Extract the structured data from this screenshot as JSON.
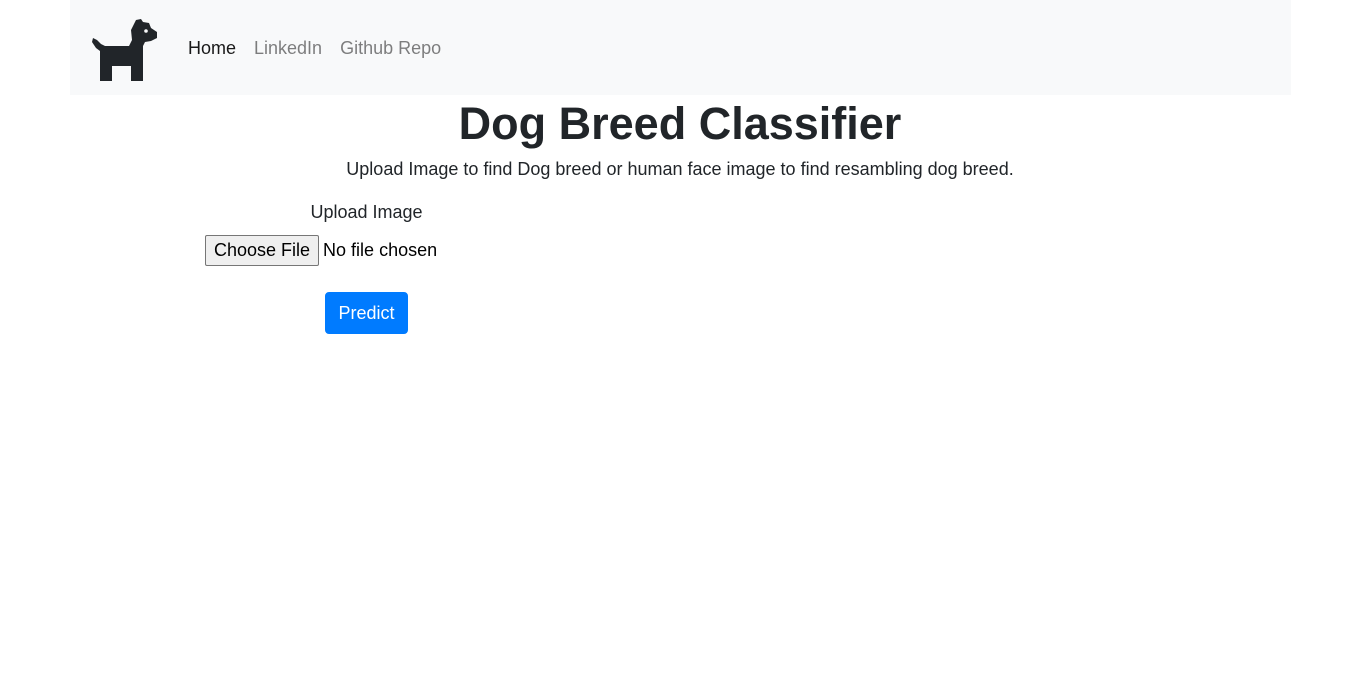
{
  "nav": {
    "logo_icon": "dog-icon",
    "items": [
      {
        "label": "Home",
        "active": true
      },
      {
        "label": "LinkedIn",
        "active": false
      },
      {
        "label": "Github Repo",
        "active": false
      }
    ]
  },
  "main": {
    "title": "Dog Breed Classifier",
    "subtitle": "Upload Image to find Dog breed or human face image to find resambling dog breed."
  },
  "form": {
    "upload_label": "Upload Image",
    "choose_file_label": "Choose File",
    "file_status": "No file chosen",
    "predict_label": "Predict"
  },
  "colors": {
    "navbar_bg": "#f8f9fa",
    "primary": "#007bff",
    "text": "#212529"
  }
}
